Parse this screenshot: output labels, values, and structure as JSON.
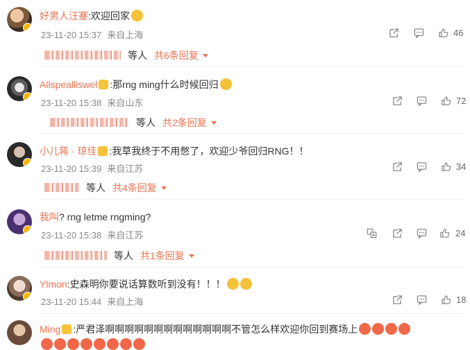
{
  "comments": [
    {
      "username": "好男人汪蹇",
      "text": ":欢迎回家",
      "emoji": true,
      "time": "23-11-20 15:37",
      "location": "来自上海",
      "likes": "46",
      "replies_text": "等人",
      "replies_more": "共6条回复"
    },
    {
      "username": "Allspealliswel",
      "text": ":那rng ming什么时候回归",
      "emoji": true,
      "time": "23-11-20 15:38",
      "location": "来自山东",
      "likes": "72",
      "replies_text": "等人",
      "replies_more": "共2条回复"
    },
    {
      "username": "小儿蒋 · 琼佳",
      "text": ":我草我终于不用憋了，欢迎少爷回归RNG！！",
      "emoji": false,
      "time": "23-11-20 15:39",
      "location": "来自江苏",
      "likes": "34",
      "replies_text": "等人",
      "replies_more": "共4条回复"
    },
    {
      "username": "我叫",
      "text": "? rng letme rngming?",
      "emoji": false,
      "time": "23-11-20 15:38",
      "location": "来自江苏",
      "likes": "24",
      "replies_text": "等人",
      "replies_more": "共1条回复"
    },
    {
      "username": "Ylmon",
      "text": ":史森明你要说话算数听到没有！！！",
      "emoji": true,
      "time": "23-11-20 15:44",
      "location": "来自上海",
      "likes": "18",
      "replies_text": "",
      "replies_more": ""
    },
    {
      "username": "Ming",
      "text": ":严君泽啊啊啊啊啊啊啊啊啊啊啊啊啊不管怎么样欢迎你回到赛场上",
      "emoji": true,
      "time": "",
      "location": "",
      "likes": "",
      "replies_text": "",
      "replies_more": ""
    }
  ],
  "icons": {
    "share": "share-icon",
    "comment": "comment-icon",
    "like": "like-icon",
    "verified": "verified-badge-icon",
    "vip": "crown-icon"
  },
  "colors": {
    "username": "#eb7350",
    "meta": "#888888",
    "accent": "#eb7350"
  }
}
